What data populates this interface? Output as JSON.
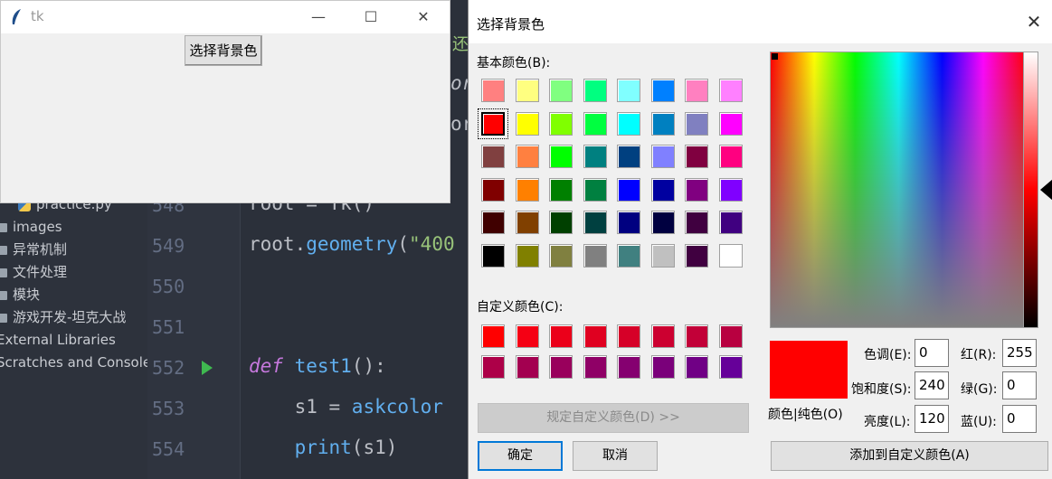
{
  "ide": {
    "tree": [
      {
        "label": "practice.py",
        "icon": "python-file-icon"
      },
      {
        "label": "images",
        "icon": "folder-icon"
      },
      {
        "label": "异常机制",
        "icon": "folder-icon"
      },
      {
        "label": "文件处理",
        "icon": "folder-icon"
      },
      {
        "label": "模块",
        "icon": "folder-icon"
      },
      {
        "label": "游戏开发-坦克大战",
        "icon": "folder-icon"
      },
      {
        "label": "External Libraries",
        "icon": ""
      },
      {
        "label": "Scratches and Consoles",
        "icon": ""
      }
    ],
    "line_numbers": [
      "548",
      "549",
      "550",
      "551",
      "552",
      "553",
      "554"
    ],
    "code": {
      "l548": "root = Tk()",
      "l549_a": "root.",
      "l549_b": "geometry",
      "l549_c": "(",
      "l549_d": "\"400",
      "l552_kw": "def",
      "l552_fn": "test1",
      "l552_rest": "():",
      "l553_a": "    s1 = ",
      "l553_b": "askcolor",
      "l554_a": "    ",
      "l554_b": "print",
      "l554_c": "(s1)",
      "top_frag_1": "还",
      "top_frag_2": "or",
      "top_frag_3": "or"
    }
  },
  "tk_window": {
    "title": "tk",
    "button_label": "选择背景色",
    "controls": {
      "minimize": "—",
      "maximize": "☐",
      "close": "✕"
    }
  },
  "dialog": {
    "title": "选择背景色",
    "close": "✕",
    "basic_colors_label": "基本颜色(B):",
    "basic_colors": [
      [
        "#ff8080",
        "#ffff80",
        "#80ff80",
        "#00ff80",
        "#80ffff",
        "#0080ff",
        "#ff80c0",
        "#ff80ff"
      ],
      [
        "#ff0000",
        "#ffff00",
        "#80ff00",
        "#00ff40",
        "#00ffff",
        "#0080c0",
        "#8080c0",
        "#ff00ff"
      ],
      [
        "#804040",
        "#ff8040",
        "#00ff00",
        "#008080",
        "#004080",
        "#8080ff",
        "#800040",
        "#ff0080"
      ],
      [
        "#800000",
        "#ff8000",
        "#008000",
        "#008040",
        "#0000ff",
        "#0000a0",
        "#800080",
        "#8000ff"
      ],
      [
        "#400000",
        "#804000",
        "#004000",
        "#004040",
        "#000080",
        "#000040",
        "#400040",
        "#400080"
      ],
      [
        "#000000",
        "#808000",
        "#808040",
        "#808080",
        "#408080",
        "#c0c0c0",
        "#400040",
        "#ffffff"
      ]
    ],
    "custom_colors_label": "自定义颜色(C):",
    "custom_colors": [
      [
        "#ff0000",
        "#f50014",
        "#eb001a",
        "#e00020",
        "#d60028",
        "#cc0030",
        "#c20038",
        "#b80040"
      ],
      [
        "#ad0048",
        "#a30050",
        "#99005c",
        "#8f0066",
        "#850070",
        "#7a007a",
        "#700085",
        "#660099"
      ]
    ],
    "define_custom_button": "规定自定义颜色(D) >>",
    "ok_button": "确定",
    "cancel_button": "取消",
    "preview_label": "颜色|纯色(O)",
    "hue_label": "色调(E):",
    "hue_value": "0",
    "sat_label": "饱和度(S):",
    "sat_value": "240",
    "lum_label": "亮度(L):",
    "lum_value": "120",
    "red_label": "红(R):",
    "red_value": "255",
    "green_label": "绿(G):",
    "green_value": "0",
    "blue_label": "蓝(U):",
    "blue_value": "0",
    "add_custom_button": "添加到自定义颜色(A)",
    "current_color": "#ff0000"
  }
}
